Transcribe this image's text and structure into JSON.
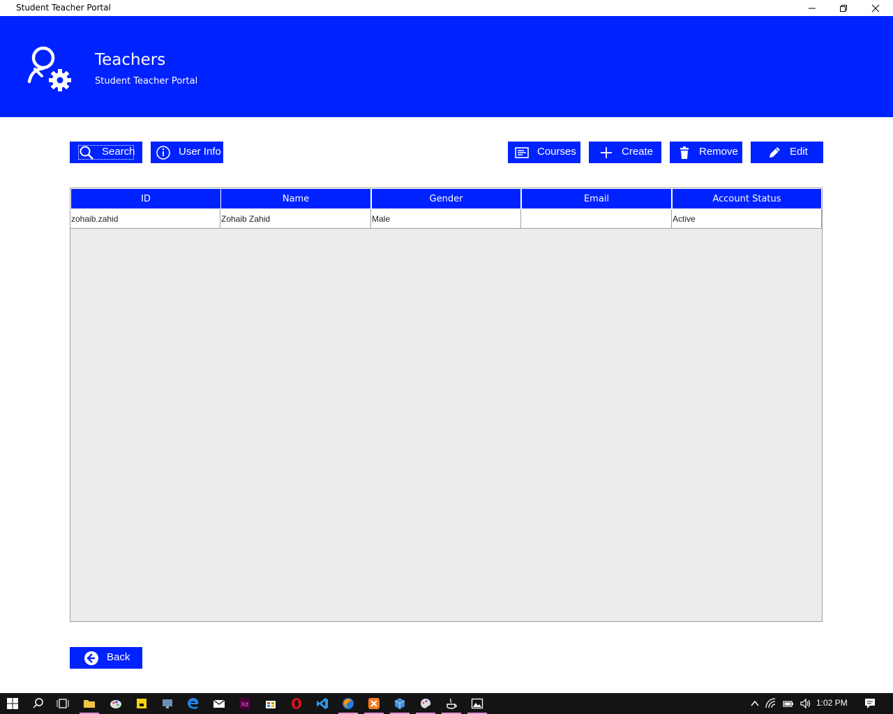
{
  "window": {
    "title": "Student Teacher Portal"
  },
  "header": {
    "title": "Teachers",
    "subtitle": "Student Teacher Portal"
  },
  "toolbar": {
    "search_label": "Search",
    "userinfo_label": "User Info",
    "courses_label": "Courses",
    "create_label": "Create",
    "remove_label": "Remove",
    "edit_label": "Edit"
  },
  "table": {
    "columns": [
      "ID",
      "Name",
      "Gender",
      "Email",
      "Account Status"
    ],
    "rows": [
      [
        "zohaib.zahid",
        "Zohaib Zahid",
        "Male",
        "",
        "Active"
      ]
    ]
  },
  "footer": {
    "back_label": "Back"
  },
  "taskbar": {
    "clock": "1:02 PM"
  },
  "colors": {
    "accent": "#0022ff",
    "table_bg": "#ececec",
    "taskbar": "#141414"
  }
}
